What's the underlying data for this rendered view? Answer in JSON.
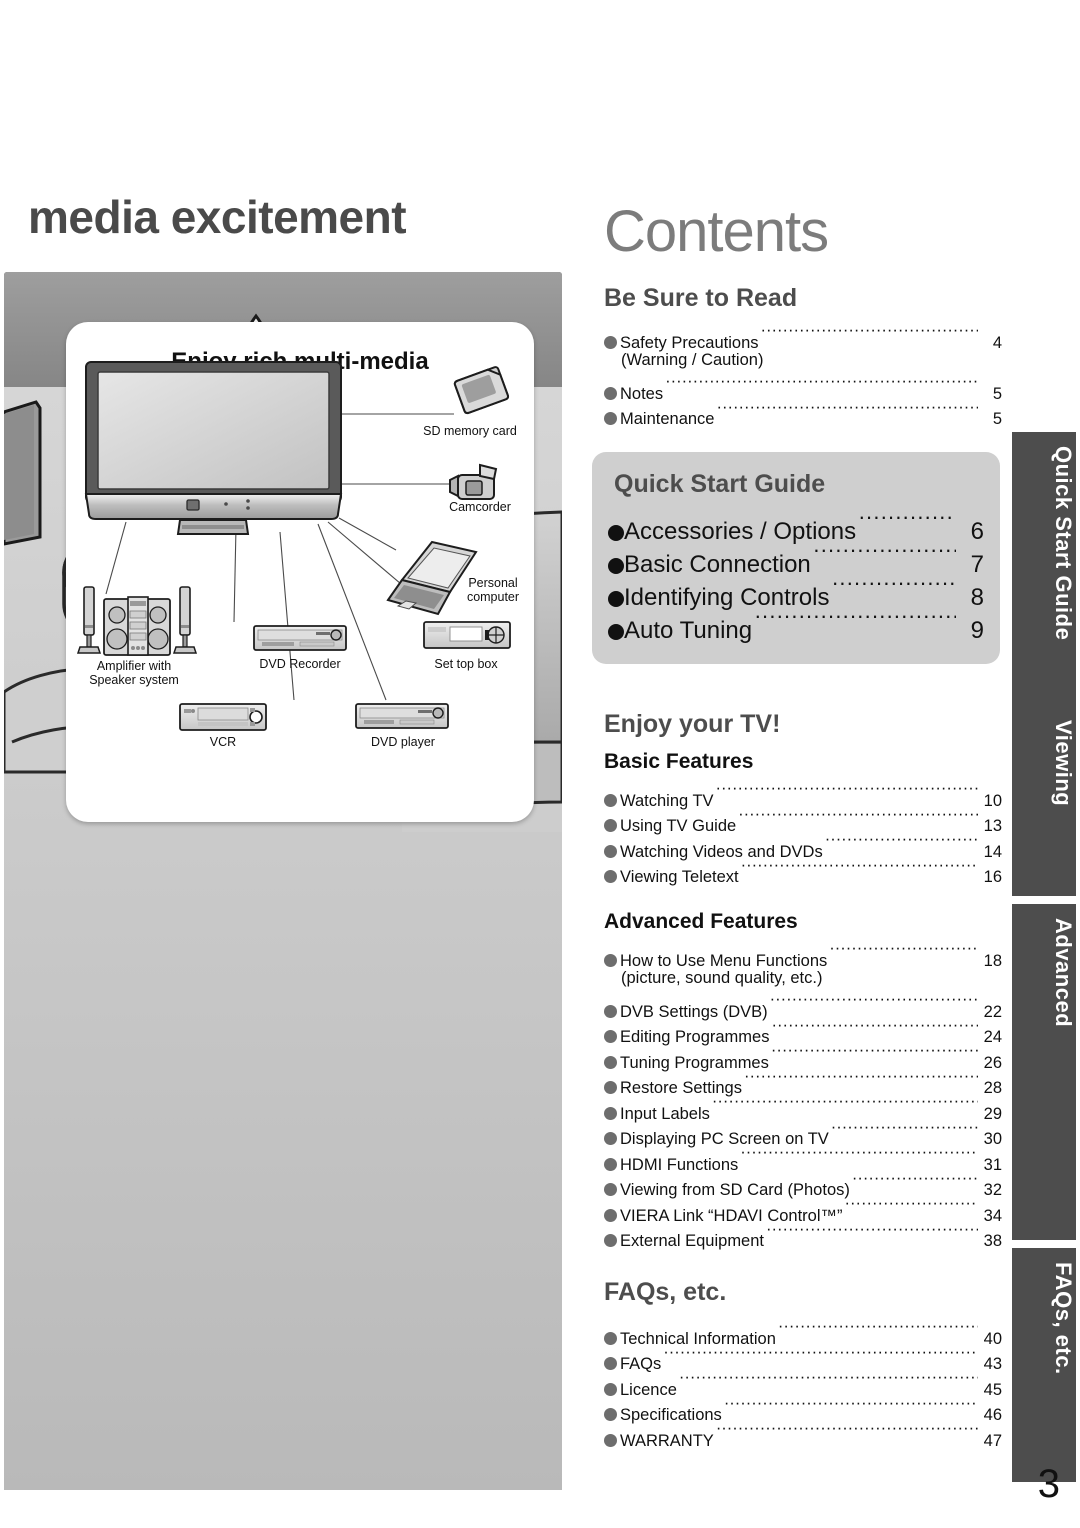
{
  "left": {
    "heading": "media excitement",
    "diagram": {
      "title": "Enjoy rich multi-media",
      "devices": [
        {
          "name": "SD memory card"
        },
        {
          "name": "Camcorder"
        },
        {
          "name": "Personal\ncomputer"
        },
        {
          "name": "Amplifier with\nSpeaker system"
        },
        {
          "name": "DVD Recorder"
        },
        {
          "name": "Set top box"
        },
        {
          "name": "VCR"
        },
        {
          "name": "DVD player"
        }
      ],
      "device_labels": {
        "sd": "SD memory card",
        "camcorder": "Camcorder",
        "pc_line1": "Personal",
        "pc_line2": "computer",
        "amp_line1": "Amplifier with",
        "amp_line2": "Speaker system",
        "dvd_recorder": "DVD Recorder",
        "set_top_box": "Set top box",
        "vcr": "VCR",
        "dvd_player": "DVD player"
      }
    }
  },
  "right": {
    "title": "Contents",
    "sections": {
      "be_sure": {
        "heading": "Be Sure to Read",
        "items": [
          {
            "label": "Safety Precautions",
            "page": "4"
          },
          {
            "label": "Notes",
            "page": "5"
          },
          {
            "label": "Maintenance",
            "page": "5"
          }
        ],
        "note": "(Warning / Caution)"
      },
      "quick_start": {
        "heading": "Quick Start Guide",
        "items": [
          {
            "label": "Accessories / Options",
            "page": "6"
          },
          {
            "label": "Basic Connection",
            "page": "7"
          },
          {
            "label": "Identifying Controls",
            "page": "8"
          },
          {
            "label": "Auto Tuning",
            "page": "9"
          }
        ]
      },
      "enjoy": {
        "heading": "Enjoy your TV!",
        "basic": {
          "heading": "Basic Features",
          "items": [
            {
              "label": "Watching TV",
              "page": "10"
            },
            {
              "label": "Using TV Guide",
              "page": "13"
            },
            {
              "label": "Watching Videos and DVDs",
              "page": "14"
            },
            {
              "label": "Viewing Teletext",
              "page": "16"
            }
          ]
        },
        "advanced": {
          "heading": "Advanced Features",
          "note": "(picture, sound quality, etc.)",
          "items": [
            {
              "label": "How to Use Menu Functions",
              "page": "18"
            },
            {
              "label": "DVB Settings (DVB)",
              "page": "22"
            },
            {
              "label": "Editing Programmes",
              "page": "24"
            },
            {
              "label": "Tuning Programmes",
              "page": "26"
            },
            {
              "label": "Restore Settings",
              "page": "28"
            },
            {
              "label": "Input Labels",
              "page": "29"
            },
            {
              "label": "Displaying PC Screen on TV",
              "page": "30"
            },
            {
              "label": "HDMI Functions",
              "page": "31"
            },
            {
              "label": "Viewing from SD Card (Photos)",
              "page": "32"
            },
            {
              "label": "VIERA Link “HDAVI Control™”",
              "page": "34"
            },
            {
              "label": "External Equipment",
              "page": "38"
            }
          ]
        }
      },
      "faqs": {
        "heading": "FAQs, etc.",
        "items": [
          {
            "label": "Technical Information",
            "page": "40"
          },
          {
            "label": "FAQs",
            "page": "43"
          },
          {
            "label": "Licence",
            "page": "45"
          },
          {
            "label": "Specifications",
            "page": "46"
          },
          {
            "label": "WARRANTY",
            "page": "47"
          }
        ]
      }
    },
    "tabs": [
      {
        "label": "Quick Start Guide"
      },
      {
        "label": "Viewing"
      },
      {
        "label": "Advanced"
      },
      {
        "label": "FAQs, etc."
      }
    ]
  },
  "page_number": "3",
  "colors": {
    "tab_bg": "#4d4d4d",
    "heading_gray": "#4d4d4d",
    "contents_gray": "#7c7c7c",
    "qsg_box_bg": "#cfcfcf",
    "bullet_gray": "#6d6d6d",
    "bullet_black": "#111111",
    "panel_gray": "#8a8a8a"
  }
}
